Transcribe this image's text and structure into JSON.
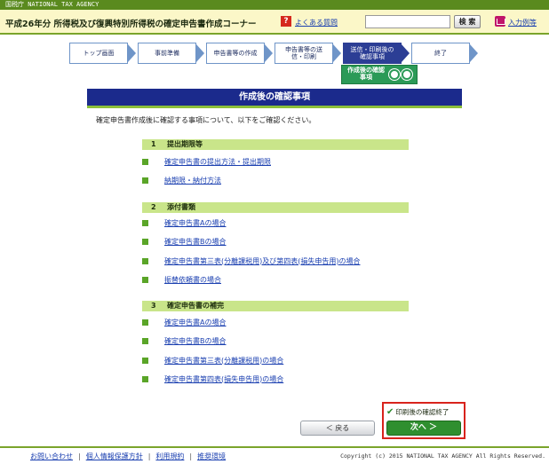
{
  "topbar": {
    "text": "国税庁 NATIONAL TAX AGENCY"
  },
  "header": {
    "title": "平成26年分 所得税及び復興特別所得税の確定申告書作成コーナー",
    "faq_link": "よくある質問",
    "search_placeholder": "",
    "search_button": "検 索",
    "example_link": "入力例等"
  },
  "steps": [
    {
      "label": "トップ画面"
    },
    {
      "label": "事前準備"
    },
    {
      "label": "申告書等の作成"
    },
    {
      "label": "申告書等の送信・印刷"
    },
    {
      "label": "送信・印刷後の確認事項"
    },
    {
      "label": "終了"
    }
  ],
  "substep": {
    "label": "作成後の確認事項"
  },
  "section": {
    "title": "作成後の確認事項",
    "intro": "確定申告書作成後に確認する事項について、以下をご確認ください。"
  },
  "groups": [
    {
      "num": "1",
      "title": "提出期限等",
      "links": [
        "確定申告書の提出方法・提出期限",
        "納期限・納付方法"
      ]
    },
    {
      "num": "2",
      "title": "添付書類",
      "links": [
        "確定申告書Aの場合",
        "確定申告書Bの場合",
        "確定申告書第三表(分離課税用)及び第四表(損失申告用)の場合",
        "振替依頼書の場合"
      ]
    },
    {
      "num": "3",
      "title": "確定申告書の補完",
      "links": [
        "確定申告書Aの場合",
        "確定申告書Bの場合",
        "確定申告書第三表(分離課税用)の場合",
        "確定申告書第四表(損失申告用)の場合"
      ]
    }
  ],
  "actions": {
    "confirm_label": "印刷後の確認終了",
    "next_button": "次へ ＞",
    "back_button": "＜ 戻る"
  },
  "footer": {
    "links": [
      "お問い合わせ",
      "個人情報保護方針",
      "利用規約",
      "推奨環境"
    ],
    "copyright": "Copyright (c) 2015 NATIONAL TAX AGENCY All Rights Reserved."
  },
  "colors": {
    "brand_green": "#5a8a1e",
    "header_bg": "#fbf7c8",
    "step_active": "#2c3e95",
    "section_header": "#1b2a8c",
    "group_bar": "#c9e58a",
    "next_button": "#2f8f2f",
    "confirm_border": "#d8231c"
  }
}
